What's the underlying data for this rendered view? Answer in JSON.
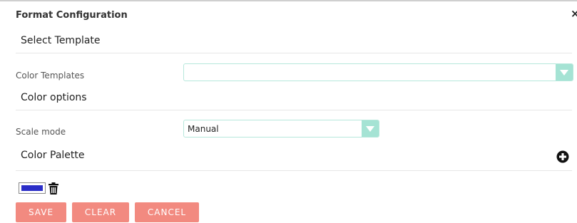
{
  "dialog": {
    "title": "Format Configuration",
    "close_glyph": "×"
  },
  "sections": {
    "template": "Select Template",
    "color_options": "Color options",
    "palette": "Color Palette"
  },
  "fields": {
    "color_templates": {
      "label": "Color Templates",
      "value": ""
    },
    "scale_mode": {
      "label": "Scale mode",
      "value": "Manual"
    }
  },
  "palette": {
    "swatch_color": "#2a2dc7",
    "add_icon": "plus-circle-icon",
    "delete_icon": "trash-icon"
  },
  "buttons": {
    "save": "SAVE",
    "clear": "CLEAR",
    "cancel": "CANCEL"
  },
  "colors": {
    "button_bg": "#f28a80",
    "select_accent": "#a5e3d4",
    "select_border": "#b6e8dc"
  }
}
